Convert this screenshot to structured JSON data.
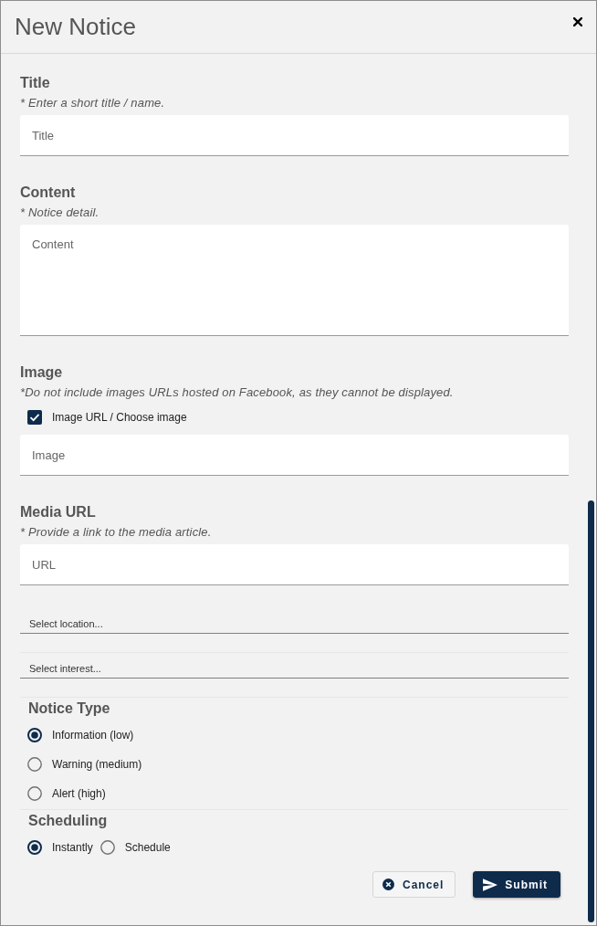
{
  "dialog": {
    "title": "New Notice"
  },
  "fields": [
    {
      "kind": "text",
      "label": "Title",
      "hint": "* Enter a short title / name.",
      "placeholder": "Title"
    },
    {
      "kind": "textarea",
      "label": "Content",
      "hint": "* Notice detail.",
      "placeholder": "Content"
    },
    {
      "kind": "text",
      "label": "Image",
      "hint": "*Do not include images URLs hosted on Facebook, as they cannot be displayed.",
      "checkbox": {
        "label": "Image URL / Choose image",
        "checked": true
      },
      "placeholder": "Image"
    },
    {
      "kind": "text",
      "label": "Media URL",
      "hint": "* Provide a link to the media article.",
      "placeholder": "URL"
    }
  ],
  "selects": [
    {
      "placeholder": "Select location..."
    },
    {
      "placeholder": "Select interest..."
    }
  ],
  "radio_groups": [
    {
      "kind": "stacked",
      "label": "Notice Type",
      "options": [
        {
          "label": "Information (low)",
          "selected": true
        },
        {
          "label": "Warning (medium)",
          "selected": false
        },
        {
          "label": "Alert (high)",
          "selected": false
        }
      ]
    },
    {
      "kind": "inline",
      "label": "Scheduling",
      "options": [
        {
          "label": "Instantly",
          "selected": true
        },
        {
          "label": "Schedule",
          "selected": false
        }
      ]
    }
  ],
  "buttons": [
    {
      "kind": "cancel",
      "label": "Cancel"
    },
    {
      "kind": "submit",
      "label": "Submit"
    }
  ]
}
